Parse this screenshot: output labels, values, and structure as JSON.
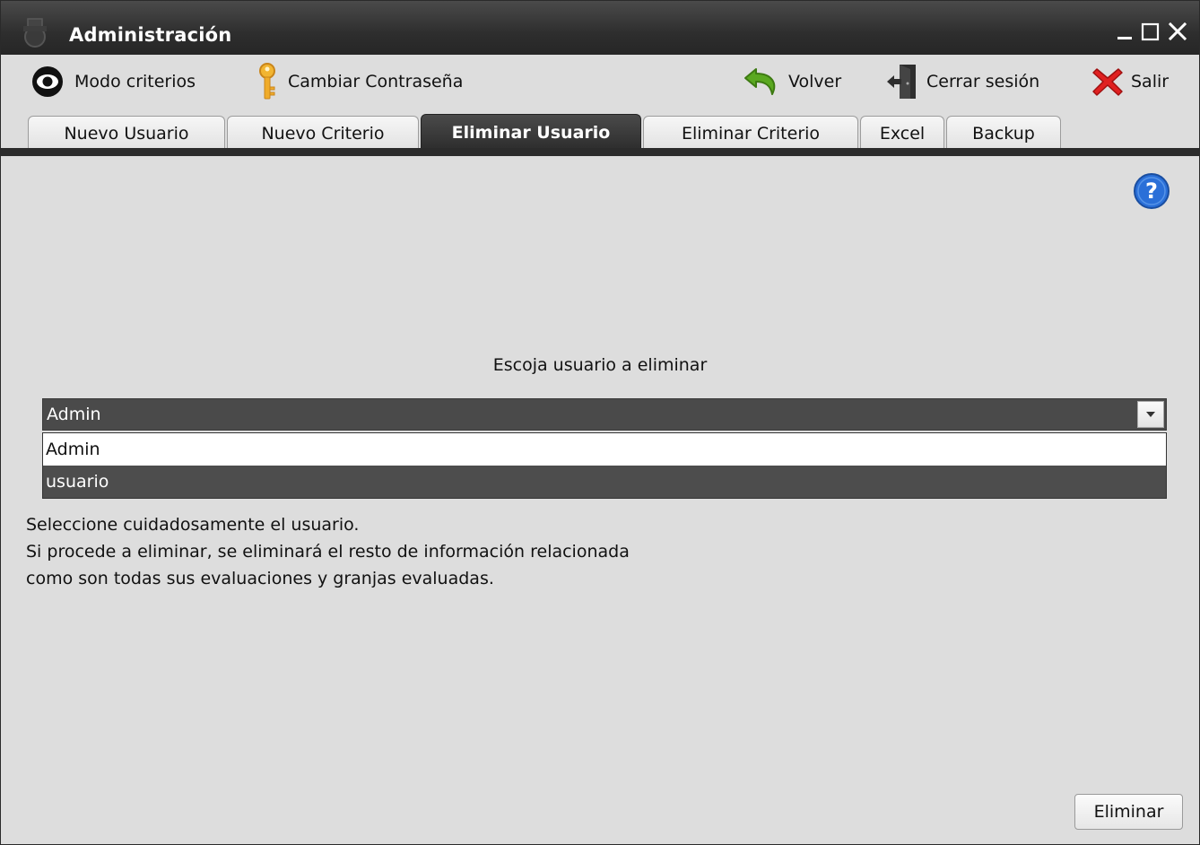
{
  "window": {
    "title": "Administración",
    "app_icon": "tractor-icon",
    "controls": {
      "minimize_icon": "minimize-icon",
      "maximize_icon": "maximize-icon",
      "close_icon": "close-icon"
    }
  },
  "toolbar": {
    "modo_criterios": {
      "label": "Modo criterios",
      "icon": "eye-icon"
    },
    "cambiar_contrasena": {
      "label": "Cambiar Contraseña",
      "icon": "key-icon"
    },
    "volver": {
      "label": "Volver",
      "icon": "back-arrow-icon"
    },
    "cerrar_sesion": {
      "label": "Cerrar sesión",
      "icon": "logout-door-icon"
    },
    "salir": {
      "label": "Salir",
      "icon": "red-x-icon"
    }
  },
  "tabs": [
    {
      "label": "Nuevo Usuario",
      "active": false
    },
    {
      "label": "Nuevo Criterio",
      "active": false
    },
    {
      "label": "Eliminar Usuario",
      "active": true
    },
    {
      "label": "Eliminar Criterio",
      "active": false
    },
    {
      "label": "Excel",
      "active": false
    },
    {
      "label": "Backup",
      "active": false
    }
  ],
  "main": {
    "prompt": "Escoja usuario a eliminar",
    "user_select": {
      "selected": "Admin",
      "options": [
        "Admin",
        "usuario"
      ],
      "highlighted_option": "usuario"
    },
    "warning_lines": [
      "Seleccione cuidadosamente el usuario.",
      "Si procede a eliminar, se eliminará el resto de información relacionada",
      "como son todas sus evaluaciones y granjas evaluadas."
    ],
    "delete_button": "Eliminar",
    "help_icon": "help-icon"
  },
  "colors": {
    "titlebar": "#2e2e2e",
    "active_tab": "#3a3a3a",
    "window_bg": "#dddddd",
    "selection": "#4d4d4d",
    "help_blue": "#2a6fd8",
    "exit_red": "#e02020"
  }
}
